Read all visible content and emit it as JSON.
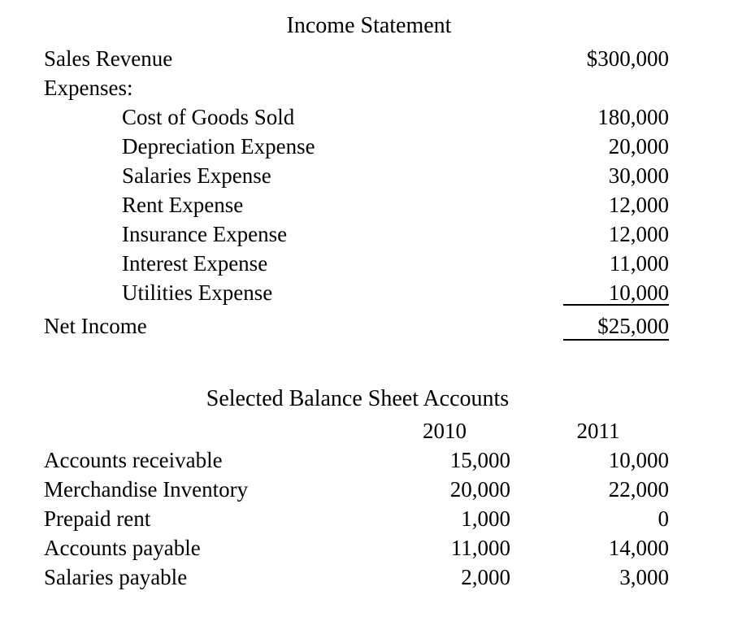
{
  "income_statement": {
    "title": "Income Statement",
    "rows": [
      {
        "label": "Sales Revenue",
        "indent": false,
        "amount": "$300,000"
      },
      {
        "label": "Expenses:",
        "indent": false,
        "amount": ""
      },
      {
        "label": "Cost of Goods Sold",
        "indent": true,
        "amount": "180,000"
      },
      {
        "label": "Depreciation Expense",
        "indent": true,
        "amount": "20,000"
      },
      {
        "label": "Salaries Expense",
        "indent": true,
        "amount": "30,000"
      },
      {
        "label": "Rent Expense",
        "indent": true,
        "amount": "12,000"
      },
      {
        "label": "Insurance Expense",
        "indent": true,
        "amount": "12,000"
      },
      {
        "label": "Interest Expense",
        "indent": true,
        "amount": "11,000"
      },
      {
        "label": "Utilities Expense",
        "indent": true,
        "amount": "10,000"
      },
      {
        "label": "Net Income",
        "indent": false,
        "amount": "$25,000"
      }
    ]
  },
  "balance_sheet": {
    "title": "Selected Balance Sheet Accounts",
    "columns": [
      "2010",
      "2011"
    ],
    "rows": [
      {
        "label": "Accounts receivable",
        "values": [
          "15,000",
          "10,000"
        ]
      },
      {
        "label": "Merchandise Inventory",
        "values": [
          "20,000",
          "22,000"
        ]
      },
      {
        "label": "Prepaid rent",
        "values": [
          "1,000",
          "0"
        ]
      },
      {
        "label": "Accounts payable",
        "values": [
          "11,000",
          "14,000"
        ]
      },
      {
        "label": "Salaries payable",
        "values": [
          "2,000",
          "3,000"
        ]
      }
    ]
  }
}
